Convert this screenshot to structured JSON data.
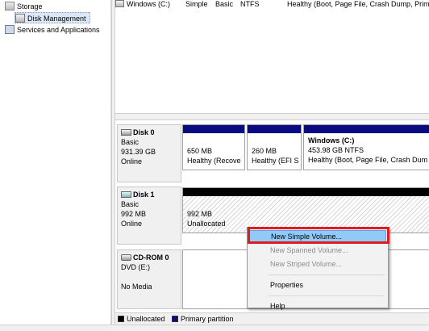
{
  "tree": {
    "items": [
      {
        "label": "Storage",
        "icon": "storage-icon"
      },
      {
        "label": "Disk Management",
        "icon": "disk-management-icon"
      },
      {
        "label": "Services and Applications",
        "icon": "services-icon"
      }
    ]
  },
  "volume_list": {
    "row": {
      "volume": "Windows (C:)",
      "layout": "Simple",
      "type": "Basic",
      "filesystem": "NTFS",
      "status": "Healthy (Boot, Page File, Crash Dump, Prim"
    }
  },
  "disks": [
    {
      "name": "Disk 0",
      "type": "Basic",
      "size": "931.39 GB",
      "state": "Online",
      "partitions": [
        {
          "title": "",
          "size": "650 MB",
          "status": "Healthy (Recove"
        },
        {
          "title": "",
          "size": "260 MB",
          "status": "Healthy (EFI S"
        },
        {
          "title": "Windows  (C:)",
          "size": "453.98 GB NTFS",
          "status": "Healthy (Boot, Page File, Crash Dum"
        }
      ]
    },
    {
      "name": "Disk 1",
      "type": "Basic",
      "size": "992 MB",
      "state": "Online",
      "partitions": [
        {
          "size": "992 MB",
          "status": "Unallocated"
        }
      ]
    },
    {
      "name": "CD-ROM 0",
      "type": "DVD (E:)",
      "state": "No Media"
    }
  ],
  "legend": {
    "unallocated": "Unallocated",
    "primary": "Primary partition",
    "colors": {
      "unallocated": "#000000",
      "primary": "#0a0a82"
    }
  },
  "context_menu": {
    "items": [
      {
        "label": "New Simple Volume...",
        "enabled": true,
        "highlighted": true
      },
      {
        "label": "New Spanned Volume...",
        "enabled": false
      },
      {
        "label": "New Striped Volume...",
        "enabled": false
      },
      {
        "label": "Properties",
        "enabled": true
      },
      {
        "label": "Help",
        "enabled": true
      }
    ],
    "highlight_color": "#e01b22"
  }
}
